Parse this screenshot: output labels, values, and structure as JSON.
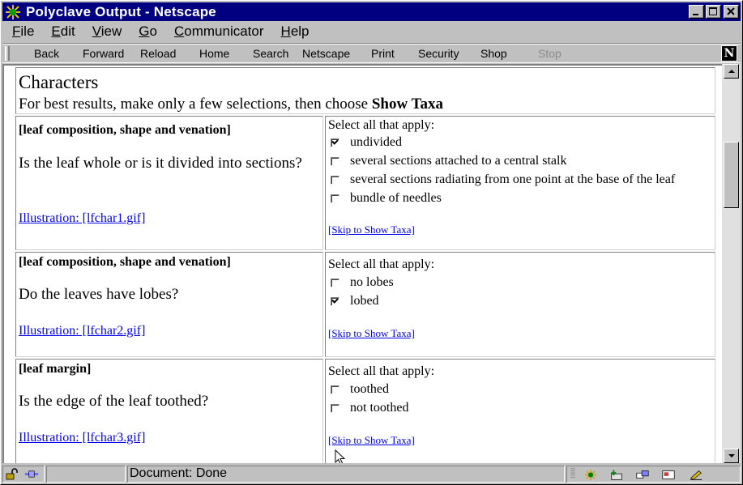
{
  "window": {
    "title": "Polyclave Output - Netscape"
  },
  "menus": [
    {
      "label": "File",
      "u": "F",
      "rest": "ile"
    },
    {
      "label": "Edit",
      "u": "E",
      "rest": "dit"
    },
    {
      "label": "View",
      "u": "V",
      "rest": "iew"
    },
    {
      "label": "Go",
      "u": "G",
      "rest": "o"
    },
    {
      "label": "Communicator",
      "u": "C",
      "rest": "ommunicator"
    },
    {
      "label": "Help",
      "u": "H",
      "rest": "elp"
    }
  ],
  "toolbar": {
    "back": "Back",
    "forward": "Forward",
    "reload": "Reload",
    "home": "Home",
    "search": "Search",
    "netscape": "Netscape",
    "print": "Print",
    "security": "Security",
    "shop": "Shop",
    "stop": "Stop"
  },
  "page": {
    "heading": "Characters",
    "instruction_pre": "For best results, make only a few selections, then choose ",
    "instruction_bold": "Show Taxa"
  },
  "questions": [
    {
      "category": "[leaf composition, shape and venation]",
      "question": "Is the leaf whole or is it divided into sections?",
      "illustration": "Illustration: [lfchar1.gif]",
      "select_label": "Select all that apply:",
      "options": [
        {
          "label": "undivided",
          "checked": true
        },
        {
          "label": "several sections attached to a central stalk",
          "checked": false
        },
        {
          "label": "several sections radiating from one point at the base of the leaf",
          "checked": false
        },
        {
          "label": "bundle of needles",
          "checked": false
        }
      ],
      "skip": "[Skip to Show Taxa]"
    },
    {
      "category": "[leaf composition, shape and venation]",
      "question": "Do the leaves have lobes?",
      "illustration": "Illustration: [lfchar2.gif]",
      "select_label": "Select all that apply:",
      "options": [
        {
          "label": "no lobes",
          "checked": false
        },
        {
          "label": "lobed",
          "checked": true
        }
      ],
      "skip": "[Skip to Show Taxa]"
    },
    {
      "category": "[leaf margin]",
      "question": "Is the edge of the leaf toothed?",
      "illustration": "Illustration: [lfchar3.gif]",
      "select_label": "Select all that apply:",
      "options": [
        {
          "label": "toothed",
          "checked": false
        },
        {
          "label": "not toothed",
          "checked": false
        }
      ],
      "skip": "[Skip to Show Taxa]"
    }
  ],
  "status": {
    "text": "Document: Done"
  },
  "colors": {
    "titlebar": "#000080",
    "link": "#0000ee",
    "chrome": "#c0c0c0"
  }
}
